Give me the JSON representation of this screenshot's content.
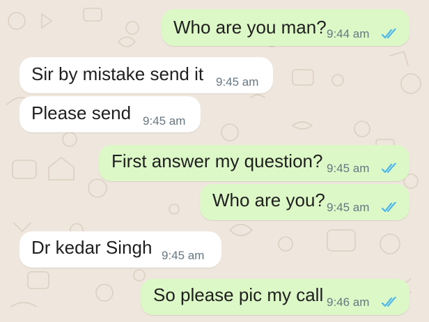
{
  "colors": {
    "outgoing_bubble": "#dcf8c6",
    "incoming_bubble": "#ffffff",
    "wallpaper": "#efe7dd",
    "read_ticks": "#4fb6ec",
    "time_text": "#667781"
  },
  "icons": {
    "read_status": "double-check-icon"
  },
  "messages": [
    {
      "direction": "outgoing",
      "text": "Who are you man?",
      "time": "9:44 am",
      "status": "read"
    },
    {
      "direction": "incoming",
      "text": "Sir by mistake send it",
      "time": "9:45 am"
    },
    {
      "direction": "incoming",
      "text": "Please send",
      "time": "9:45 am"
    },
    {
      "direction": "outgoing",
      "text": "First answer my question?",
      "time": "9:45 am",
      "status": "read"
    },
    {
      "direction": "outgoing",
      "text": "Who are you?",
      "time": "9:45 am",
      "status": "read"
    },
    {
      "direction": "incoming",
      "text": "Dr kedar Singh",
      "time": "9:45 am"
    },
    {
      "direction": "outgoing",
      "text": "So please pic my call",
      "time": "9:46 am",
      "status": "read"
    }
  ]
}
